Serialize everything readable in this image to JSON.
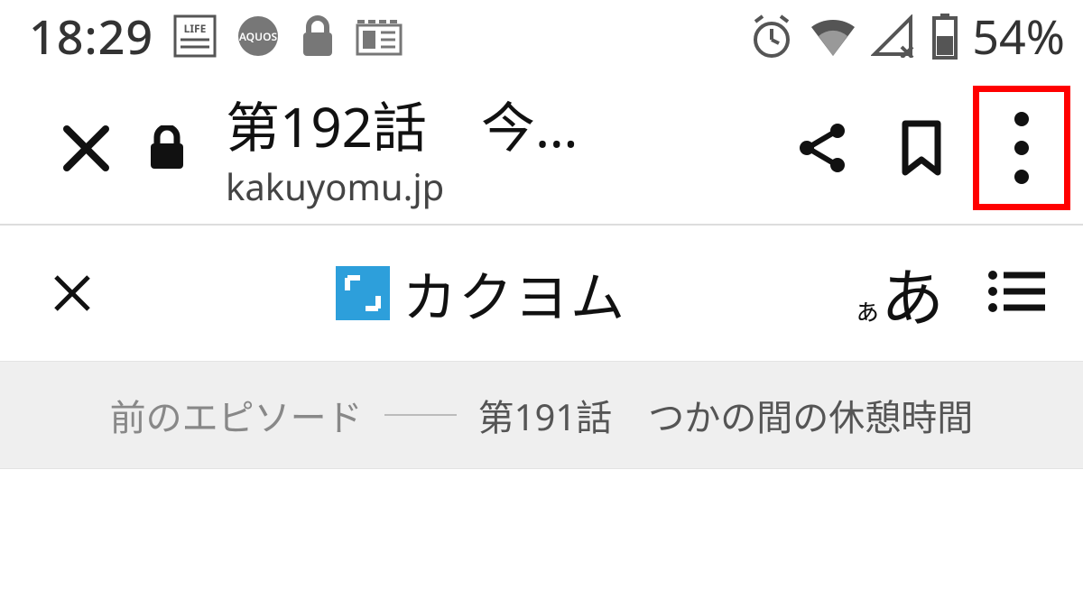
{
  "status": {
    "time": "18:29",
    "battery": "54%",
    "icons": [
      "life-app-icon",
      "aquos-icon",
      "lock-icon",
      "news-icon",
      "alarm-icon",
      "wifi-icon",
      "signal-icon",
      "battery-icon"
    ]
  },
  "chrome": {
    "page_title": "第192話　今…",
    "domain": "kakuyomu.jp"
  },
  "site": {
    "logo_mark": "「」",
    "logo_text": "カクヨム",
    "font_small": "ぁ",
    "font_big": "あ"
  },
  "prev": {
    "label": "前のエピソード",
    "title": "第191話　つかの間の休憩時間"
  }
}
